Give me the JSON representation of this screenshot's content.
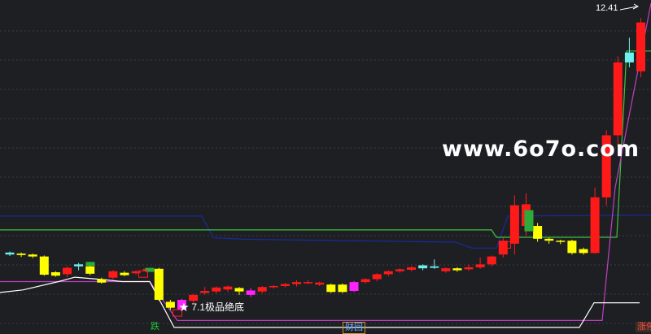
{
  "watermark": "www.6o7o.com",
  "peak_label": "12.41",
  "annotation": "★ 7.1极品绝底",
  "bottom_tags": {
    "die": "跌",
    "cai": "财回",
    "zhang": "涨停"
  },
  "colors": {
    "background": "#1e1f23",
    "up": "#ff1a1a",
    "down": "#ffff00",
    "cyan": "#6ef0f0",
    "magenta": "#ff22ff",
    "green": "#2eaa3a",
    "blue_line": "#1a2a9e",
    "green_line": "#3dc23d",
    "purple_line": "#c040c0",
    "white_line": "#ffffff"
  },
  "chart_data": {
    "type": "candlestick",
    "ylim": [
      6.4,
      12.8
    ],
    "grid": true,
    "candles": [
      [
        7.7,
        7.74,
        7.67,
        7.76,
        "cyan"
      ],
      [
        7.72,
        7.69,
        7.65,
        7.74,
        "down"
      ],
      [
        7.7,
        7.66,
        7.63,
        7.72,
        "down"
      ],
      [
        7.66,
        7.29,
        7.27,
        7.68,
        "down"
      ],
      [
        7.34,
        7.27,
        7.25,
        7.36,
        "down"
      ],
      [
        7.3,
        7.43,
        7.24,
        7.46,
        "up"
      ],
      [
        7.5,
        7.46,
        7.38,
        7.53,
        "cyan"
      ],
      [
        7.46,
        7.31,
        7.28,
        7.48,
        "down"
      ],
      [
        7.2,
        7.13,
        7.11,
        7.23,
        "down"
      ],
      [
        7.23,
        7.36,
        7.2,
        7.38,
        "up"
      ],
      [
        7.33,
        7.28,
        7.26,
        7.36,
        "down"
      ],
      [
        7.32,
        7.36,
        7.29,
        7.38,
        "up"
      ],
      [
        7.36,
        7.41,
        7.33,
        7.43,
        "up"
      ],
      [
        7.41,
        6.78,
        6.76,
        7.43,
        "down"
      ],
      [
        6.74,
        6.62,
        6.58,
        6.78,
        "down"
      ],
      [
        6.78,
        6.58,
        6.48,
        6.8,
        "magenta"
      ],
      [
        6.76,
        6.88,
        6.72,
        6.9,
        "up"
      ],
      [
        6.92,
        6.96,
        6.88,
        7.04,
        "up"
      ],
      [
        6.95,
        7.03,
        6.91,
        7.05,
        "up"
      ],
      [
        7.05,
        6.99,
        6.94,
        7.07,
        "up"
      ],
      [
        7.02,
        6.95,
        6.88,
        7.04,
        "down"
      ],
      [
        6.97,
        6.88,
        6.84,
        7.02,
        "magenta"
      ],
      [
        6.95,
        7.04,
        6.91,
        7.06,
        "up"
      ],
      [
        7.04,
        7.06,
        7.01,
        7.08,
        "up"
      ],
      [
        7.06,
        7.1,
        7.03,
        7.12,
        "up"
      ],
      [
        7.1,
        7.14,
        7.05,
        7.18,
        "up"
      ],
      [
        7.14,
        7.13,
        7.1,
        7.18,
        "up"
      ],
      [
        7.13,
        7.09,
        7.06,
        7.15,
        "up"
      ],
      [
        7.09,
        6.94,
        6.92,
        7.11,
        "down"
      ],
      [
        6.94,
        7.09,
        6.92,
        7.11,
        "down"
      ],
      [
        6.96,
        7.14,
        6.94,
        7.16,
        "magenta"
      ],
      [
        7.14,
        7.2,
        7.11,
        7.22,
        "up"
      ],
      [
        7.2,
        7.3,
        7.16,
        7.32,
        "up"
      ],
      [
        7.3,
        7.36,
        7.26,
        7.38,
        "up"
      ],
      [
        7.36,
        7.4,
        7.33,
        7.42,
        "up"
      ],
      [
        7.44,
        7.39,
        7.36,
        7.46,
        "up"
      ],
      [
        7.42,
        7.48,
        7.38,
        7.5,
        "cyan"
      ],
      [
        7.46,
        7.43,
        7.41,
        7.6,
        "cyan"
      ],
      [
        7.42,
        7.36,
        7.33,
        7.44,
        "up"
      ],
      [
        7.38,
        7.42,
        7.35,
        7.44,
        "down"
      ],
      [
        7.4,
        7.44,
        7.37,
        7.5,
        "up"
      ],
      [
        7.44,
        7.5,
        7.41,
        7.64,
        "up"
      ],
      [
        7.5,
        7.66,
        7.46,
        7.68,
        "up"
      ],
      [
        7.7,
        7.98,
        7.64,
        8.04,
        "up"
      ],
      [
        7.92,
        8.7,
        7.7,
        8.9,
        "up"
      ],
      [
        8.72,
        8.28,
        8.08,
        8.94,
        "up"
      ],
      [
        8.28,
        8.02,
        7.96,
        8.34,
        "down"
      ],
      [
        8.02,
        7.98,
        7.92,
        8.04,
        "down"
      ],
      [
        7.98,
        7.96,
        7.91,
        8,
        "down"
      ],
      [
        7.98,
        7.73,
        7.7,
        8,
        "down"
      ],
      [
        7.81,
        7.73,
        7.7,
        7.84,
        "down"
      ],
      [
        7.73,
        8.86,
        7.72,
        9.06,
        "up"
      ],
      [
        8.86,
        10.12,
        8.7,
        10.22,
        "up"
      ],
      [
        10.12,
        11.6,
        9.88,
        11.72,
        "up"
      ],
      [
        11.6,
        11.8,
        11.5,
        12.1,
        "cyan"
      ],
      [
        11.42,
        12.41,
        11.3,
        12.5,
        "up"
      ]
    ],
    "indicator_lines": {
      "blue": [
        [
          0,
          8.48
        ],
        [
          248,
          8.48
        ],
        [
          262,
          8.04
        ],
        [
          300,
          8.01
        ],
        [
          560,
          7.95
        ],
        [
          580,
          7.83
        ],
        [
          610,
          7.83
        ],
        [
          624,
          8.48
        ],
        [
          800,
          8.5
        ]
      ],
      "green": [
        [
          0,
          8.2
        ],
        [
          604,
          8.2
        ],
        [
          610,
          8.05
        ],
        [
          758,
          8.05
        ],
        [
          770,
          11.83
        ],
        [
          800,
          11.83
        ]
      ],
      "purple": [
        [
          0,
          7.15
        ],
        [
          184,
          7.15
        ],
        [
          218,
          6.36
        ],
        [
          740,
          6.36
        ],
        [
          756,
          9.06
        ],
        [
          800,
          12.8
        ]
      ],
      "white": [
        [
          0,
          6.93
        ],
        [
          28,
          6.98
        ],
        [
          72,
          7.15
        ],
        [
          92,
          7.24
        ],
        [
          128,
          7.19
        ],
        [
          150,
          7.15
        ],
        [
          184,
          7.15
        ],
        [
          214,
          6.22
        ],
        [
          712,
          6.22
        ],
        [
          730,
          6.72
        ],
        [
          786,
          6.72
        ]
      ]
    }
  }
}
